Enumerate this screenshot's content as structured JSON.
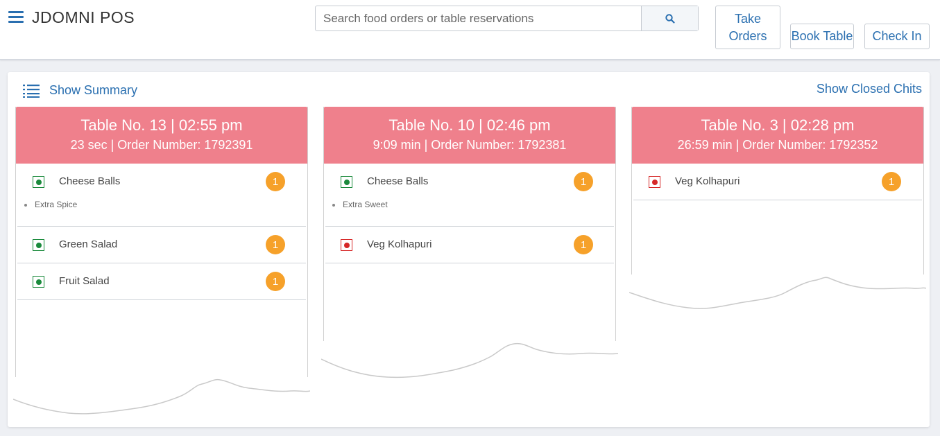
{
  "header": {
    "app_title": "JDOMNI POS",
    "search_placeholder": "Search food orders or table reservations",
    "search_icon": "search-icon",
    "buttons": {
      "take_orders_line1": "Take",
      "take_orders_line2": "Orders",
      "book_table": "Book Table",
      "check_in": "Check In"
    }
  },
  "panel": {
    "show_summary": "Show Summary",
    "show_closed_chits": "Show Closed Chits"
  },
  "colors": {
    "accent": "#2a6fb0",
    "chit_header": "#ef808c",
    "qty_badge": "#f6a12a",
    "veg": "#1a8a3c",
    "non_veg": "#d62828"
  },
  "chits": [
    {
      "title": "Table No. 13 | 02:55 pm",
      "subtitle": "23 sec | Order Number: 1792391",
      "items": [
        {
          "name": "Cheese Balls",
          "qty": "1",
          "type": "veg",
          "note": "Extra Spice"
        },
        {
          "name": "Green Salad",
          "qty": "1",
          "type": "veg",
          "note": ""
        },
        {
          "name": "Fruit Salad",
          "qty": "1",
          "type": "veg",
          "note": ""
        }
      ]
    },
    {
      "title": "Table No. 10 | 02:46 pm",
      "subtitle": "9:09 min | Order Number: 1792381",
      "items": [
        {
          "name": "Cheese Balls",
          "qty": "1",
          "type": "veg",
          "note": "Extra Sweet"
        },
        {
          "name": "Veg Kolhapuri",
          "qty": "1",
          "type": "nonveg",
          "note": ""
        }
      ]
    },
    {
      "title": "Table No. 3 | 02:28 pm",
      "subtitle": "26:59 min | Order Number: 1792352",
      "items": [
        {
          "name": "Veg Kolhapuri",
          "qty": "1",
          "type": "nonveg",
          "note": ""
        }
      ]
    }
  ]
}
